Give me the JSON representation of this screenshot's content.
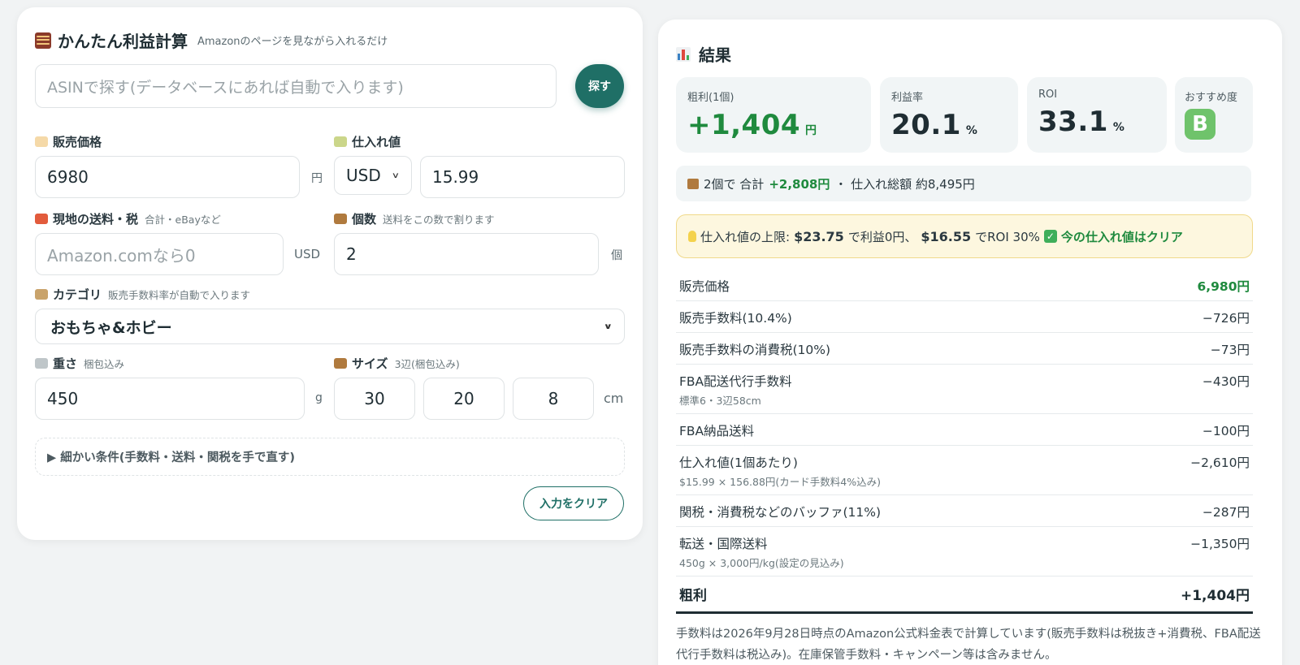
{
  "calc": {
    "title": "かんたん利益計算",
    "subtitle": "Amazonのページを見ながら入れるだけ",
    "asin_placeholder": "ASINで探す(データベースにあれば自動で入ります)",
    "search_button": "探す",
    "price_label": "販売価格",
    "price_value": "6980",
    "price_unit": "円",
    "cost_label": "仕入れ値",
    "currency": "USD",
    "cost_value": "15.99",
    "shipping_label": "現地の送料・税",
    "shipping_hint": "合計・eBayなど",
    "shipping_placeholder": "Amazon.comなら0",
    "shipping_unit": "USD",
    "qty_label": "個数",
    "qty_hint": "送料をこの数で割ります",
    "qty_value": "2",
    "qty_unit": "個",
    "category_label": "カテゴリ",
    "category_hint": "販売手数料率が自動で入ります",
    "category_value": "おもちゃ&ホビー",
    "weight_label": "重さ",
    "weight_hint": "梱包込み",
    "weight_value": "450",
    "weight_unit": "g",
    "size_label": "サイズ",
    "size_hint": "3辺(梱包込み)",
    "size_values": [
      "30",
      "20",
      "8"
    ],
    "size_unit": "cm",
    "details_label": "▶ 細かい条件(手数料・送料・関税を手で直す)",
    "clear_button": "入力をクリア"
  },
  "result": {
    "title": "結果",
    "stats": [
      {
        "label": "粗利(1個)",
        "value": "+1,404",
        "unit": "円"
      },
      {
        "label": "利益率",
        "value": "20.1",
        "unit": "%"
      },
      {
        "label": "ROI",
        "value": "33.1",
        "unit": "%"
      },
      {
        "label": "おすすめ度",
        "value": "B",
        "unit": ""
      }
    ],
    "summary": {
      "prefix": "2個で 合計",
      "total": "+2,808円",
      "suffix": "・ 仕入れ総額 約8,495円"
    },
    "alert": {
      "t1": "仕入れ値の上限:",
      "v1": "$23.75",
      "t2": "で利益0円、",
      "v2": "$16.55",
      "t3": "でROI 30%",
      "ok": "今の仕入れ値はクリア"
    },
    "rows": [
      {
        "label": "販売価格",
        "sub": "",
        "value": "6,980円"
      },
      {
        "label": "販売手数料(10.4%)",
        "sub": "",
        "value": "−726円"
      },
      {
        "label": "販売手数料の消費税(10%)",
        "sub": "",
        "value": "−73円"
      },
      {
        "label": "FBA配送代行手数料",
        "sub": "標準6・3辺58cm",
        "value": "−430円"
      },
      {
        "label": "FBA納品送料",
        "sub": "",
        "value": "−100円"
      },
      {
        "label": "仕入れ値(1個あたり)",
        "sub": "$15.99 × 156.88円(カード手数料4%込み)",
        "value": "−2,610円"
      },
      {
        "label": "関税・消費税などのバッファ(11%)",
        "sub": "",
        "value": "−287円"
      },
      {
        "label": "転送・国際送料",
        "sub": "450g × 3,000円/kg(設定の見込み)",
        "value": "−1,350円"
      }
    ],
    "total_label": "粗利",
    "total_value": "+1,404円",
    "footnote": "手数料は2026年9月28日時点のAmazon公式料金表で計算しています(販売手数料は税抜き+消費税、FBA配送代行手数料は税込み)。在庫保管手数料・キャンペーン等は含みません。"
  },
  "colors": {
    "accent": "#1f6f66",
    "profit_green": "#1f8a3e",
    "grade_b": "#6fc36b",
    "alert_bg": "#fdf7df"
  },
  "icons": [
    "abacus-icon",
    "tag-icon",
    "money-icon",
    "truck-icon",
    "box-icon",
    "bag-icon",
    "scale-icon",
    "chart-icon",
    "bulb-icon",
    "check-icon"
  ]
}
